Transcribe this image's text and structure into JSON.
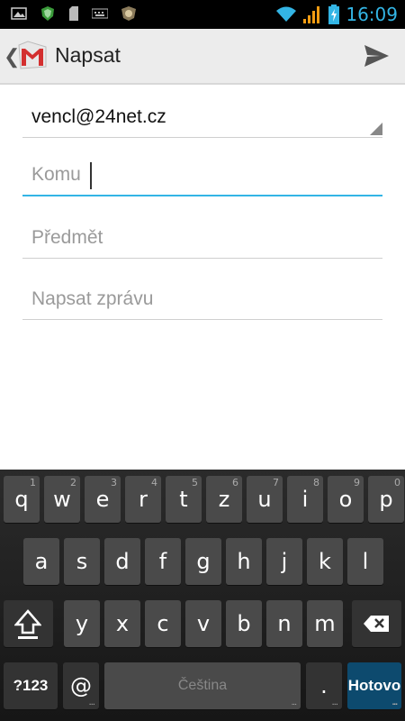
{
  "status_bar": {
    "time": "16:09",
    "time_color": "#33b5e5"
  },
  "action_bar": {
    "title": "Napsat",
    "back_glyph": "❮"
  },
  "compose": {
    "from": "vencl@24net.cz",
    "to_placeholder": "Komu",
    "subject_placeholder": "Předmět",
    "body_placeholder": "Napsat zprávu"
  },
  "keyboard": {
    "row1": [
      {
        "label": "q",
        "hint": "1"
      },
      {
        "label": "w",
        "hint": "2"
      },
      {
        "label": "e",
        "hint": "3"
      },
      {
        "label": "r",
        "hint": "4"
      },
      {
        "label": "t",
        "hint": "5"
      },
      {
        "label": "z",
        "hint": "6"
      },
      {
        "label": "u",
        "hint": "7"
      },
      {
        "label": "i",
        "hint": "8"
      },
      {
        "label": "o",
        "hint": "9"
      },
      {
        "label": "p",
        "hint": "0"
      }
    ],
    "row2": [
      "a",
      "s",
      "d",
      "f",
      "g",
      "h",
      "j",
      "k",
      "l"
    ],
    "row3": [
      "y",
      "x",
      "c",
      "v",
      "b",
      "n",
      "m"
    ],
    "symbols_label": "?123",
    "at_label": "@",
    "space_label": "Čeština",
    "period_label": ".",
    "done_label": "Hotovo",
    "ellipsis": "..."
  },
  "accent_color": "#33b5e5"
}
